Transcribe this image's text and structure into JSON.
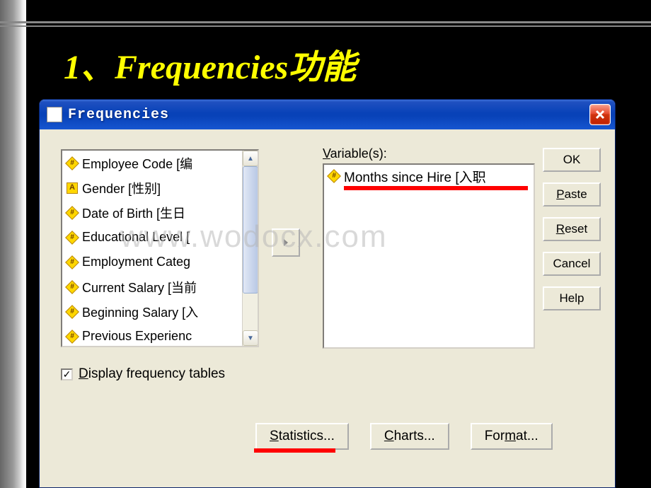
{
  "slide": {
    "title": "1、Frequencies功能"
  },
  "watermark": "www.wodocx.com",
  "dialog": {
    "title": "Frequencies",
    "variables_label_prefix": "V",
    "variables_label_rest": "ariable(s):",
    "source_vars": [
      {
        "type": "numeric",
        "label": "Employee Code [编"
      },
      {
        "type": "string",
        "label": "Gender [性别]"
      },
      {
        "type": "numeric",
        "label": "Date of Birth [生日"
      },
      {
        "type": "numeric",
        "label": "Educational Level ["
      },
      {
        "type": "numeric",
        "label": "Employment Categ"
      },
      {
        "type": "numeric",
        "label": "Current Salary [当前"
      },
      {
        "type": "numeric",
        "label": "Beginning Salary [入"
      },
      {
        "type": "numeric",
        "label": "Previous Experienc"
      }
    ],
    "target_vars": [
      {
        "type": "numeric",
        "label": "Months since Hire [入职"
      }
    ],
    "buttons": {
      "ok": "OK",
      "paste_u": "P",
      "paste_rest": "aste",
      "reset_u": "R",
      "reset_rest": "eset",
      "cancel": "Cancel",
      "help": "Help"
    },
    "checkbox": {
      "checked": true,
      "label_u": "D",
      "label_rest": "isplay frequency tables"
    },
    "bottom_buttons": {
      "statistics_u": "S",
      "statistics_rest": "tatistics...",
      "charts_u": "C",
      "charts_rest": "harts...",
      "format_pre": "For",
      "format_u": "m",
      "format_rest": "at..."
    }
  }
}
